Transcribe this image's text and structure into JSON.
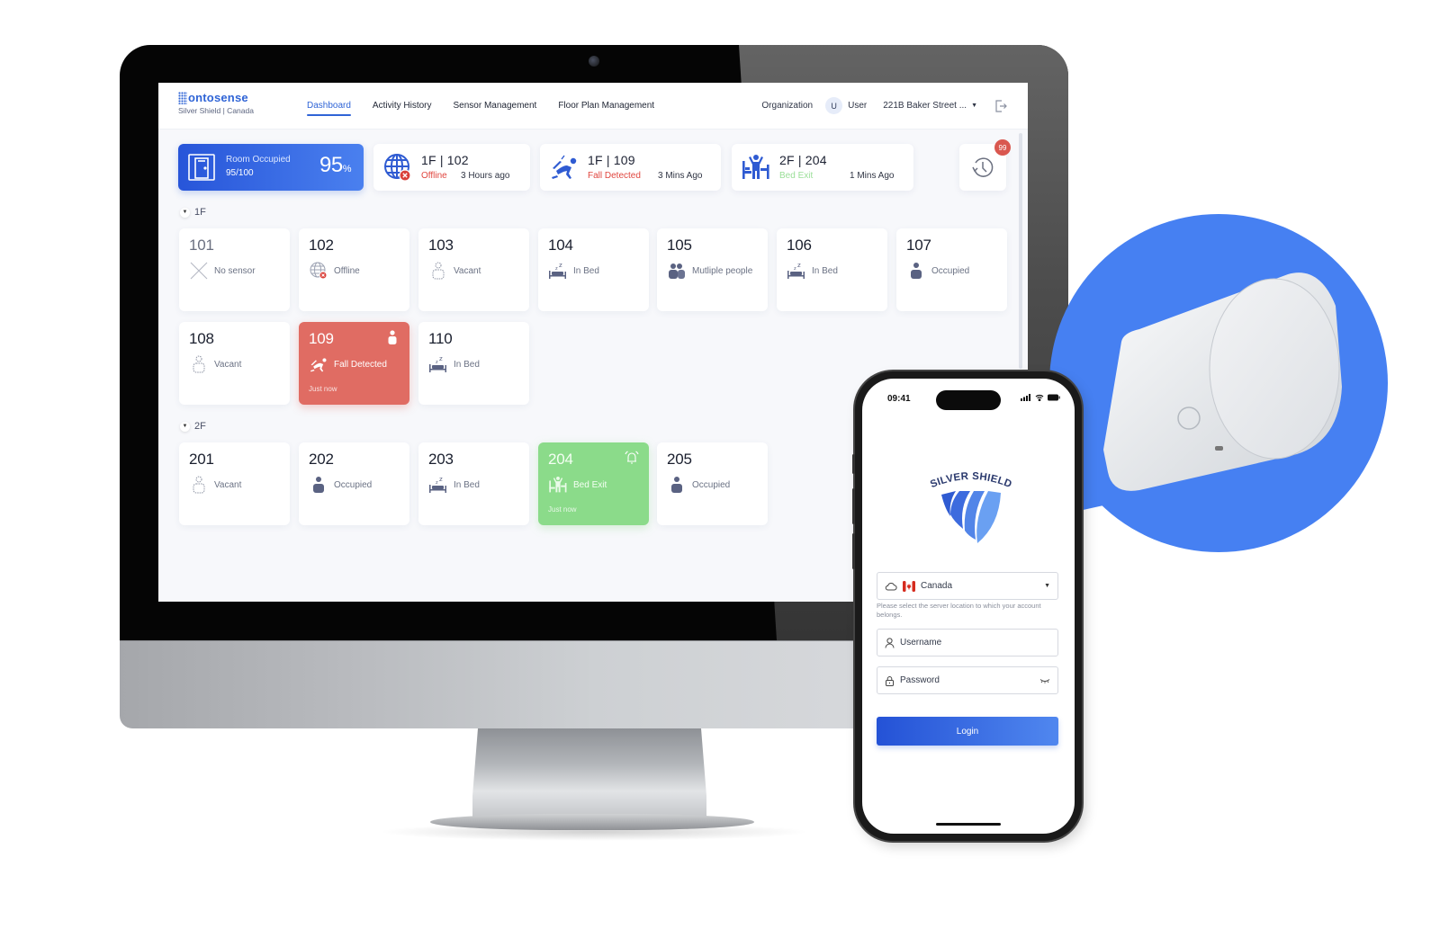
{
  "desktop": {
    "brand": {
      "name": "ontosense",
      "subtitle": "Silver Shield | Canada"
    },
    "nav": {
      "tabs": [
        {
          "label": "Dashboard",
          "active": true
        },
        {
          "label": "Activity History",
          "active": false
        },
        {
          "label": "Sensor Management",
          "active": false
        },
        {
          "label": "Floor Plan Management",
          "active": false
        }
      ],
      "organization": "Organization",
      "user_initial": "U",
      "user_name": "User",
      "address": "221B Baker Street ...",
      "logout_icon": "logout-icon"
    },
    "summary": {
      "occupancy": {
        "label": "Room Occupied",
        "count": "95/100",
        "percent": "95",
        "percent_unit": "%",
        "icon": "door-icon"
      },
      "alerts": [
        {
          "location": "1F | 102",
          "status": "Offline",
          "status_color": "#e0463f",
          "time": "3 Hours ago",
          "icon": "globe-offline-icon"
        },
        {
          "location": "1F | 109",
          "status": "Fall Detected",
          "status_color": "#e0463f",
          "time": "3 Mins Ago",
          "icon": "fall-icon"
        },
        {
          "location": "2F | 204",
          "status": "Bed Exit",
          "status_color": "#9adf98",
          "time": "1 Mins Ago",
          "icon": "bed-exit-icon"
        }
      ],
      "history": {
        "icon": "history-icon",
        "badge": "99"
      }
    },
    "floors": [
      {
        "label": "1F",
        "rooms": [
          {
            "number": "101",
            "status": "No sensor",
            "icon": "no-sensor-icon",
            "state": "nosensor"
          },
          {
            "number": "102",
            "status": "Offline",
            "icon": "offline-icon",
            "state": "normal"
          },
          {
            "number": "103",
            "status": "Vacant",
            "icon": "vacant-icon",
            "state": "normal"
          },
          {
            "number": "104",
            "status": "In Bed",
            "icon": "in-bed-icon",
            "state": "normal"
          },
          {
            "number": "105",
            "status": "Mutliple people",
            "icon": "multiple-people-icon",
            "state": "normal"
          },
          {
            "number": "106",
            "status": "In Bed",
            "icon": "in-bed-icon",
            "state": "normal"
          },
          {
            "number": "107",
            "status": "Occupied",
            "icon": "occupied-icon",
            "state": "normal"
          },
          {
            "number": "108",
            "status": "Vacant",
            "icon": "vacant-icon",
            "state": "normal"
          },
          {
            "number": "109",
            "status": "Fall Detected",
            "icon": "fall-icon",
            "state": "fall",
            "sub": "Just now",
            "corner_icon": "person-icon"
          },
          {
            "number": "110",
            "status": "In Bed",
            "icon": "in-bed-icon",
            "state": "normal"
          }
        ]
      },
      {
        "label": "2F",
        "rooms": [
          {
            "number": "201",
            "status": "Vacant",
            "icon": "vacant-icon",
            "state": "normal"
          },
          {
            "number": "202",
            "status": "Occupied",
            "icon": "occupied-icon",
            "state": "normal"
          },
          {
            "number": "203",
            "status": "In Bed",
            "icon": "in-bed-icon",
            "state": "normal"
          },
          {
            "number": "204",
            "status": "Bed Exit",
            "icon": "bed-exit-icon",
            "state": "exit",
            "sub": "Just now",
            "corner_icon": "alarm-bell-icon"
          },
          {
            "number": "205",
            "status": "Occupied",
            "icon": "occupied-icon",
            "state": "normal"
          }
        ]
      }
    ]
  },
  "phone": {
    "status_time": "09:41",
    "logo_text": "SILVER SHIELD",
    "server": {
      "value": "Canada",
      "hint": "Please select the server location to which your account belongs."
    },
    "username": {
      "placeholder": "Username"
    },
    "password": {
      "placeholder": "Password"
    },
    "login_label": "Login"
  },
  "colors": {
    "accent": "#2f64d6",
    "fall": "#e06c63",
    "bed_exit": "#8bdb8a",
    "bubble": "#4680f2",
    "icon_gray": "#5a6282"
  }
}
